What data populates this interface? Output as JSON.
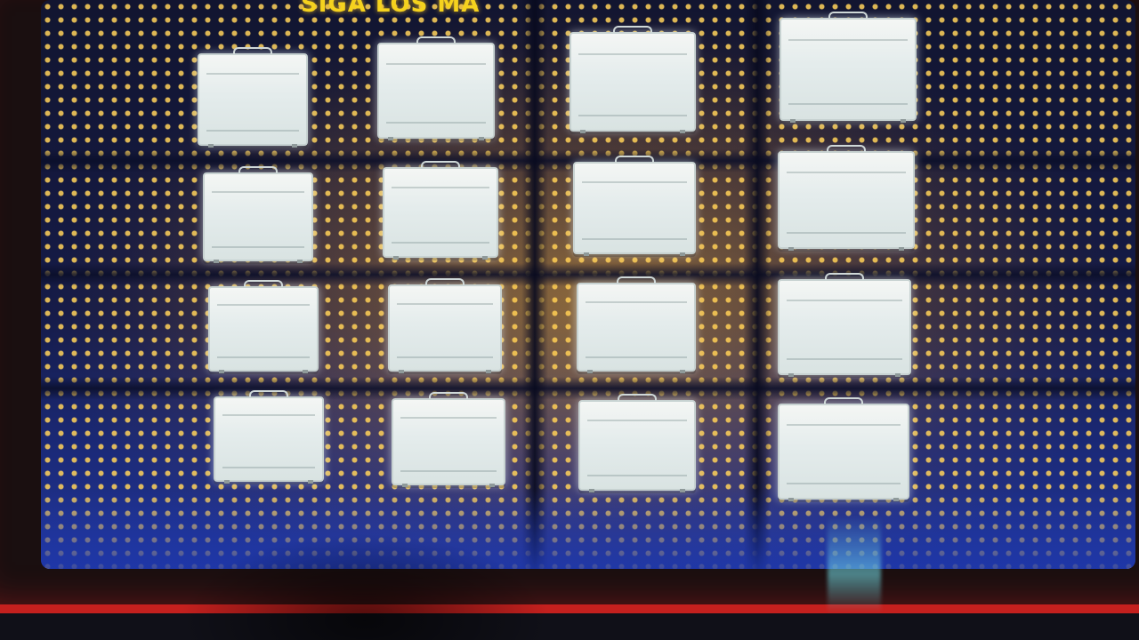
{
  "game": {
    "title": "SIGA LOS MA"
  },
  "colors": {
    "frame_red": "#c4201e",
    "title_yellow": "#f5d21e",
    "light_dots": "#ffd25a",
    "screen_blue": "#1b2a7a",
    "case_silver": "#e4ecec"
  },
  "briefcases": {
    "rows": 4,
    "columns": 4,
    "count": 16,
    "icon": "briefcase-icon"
  }
}
